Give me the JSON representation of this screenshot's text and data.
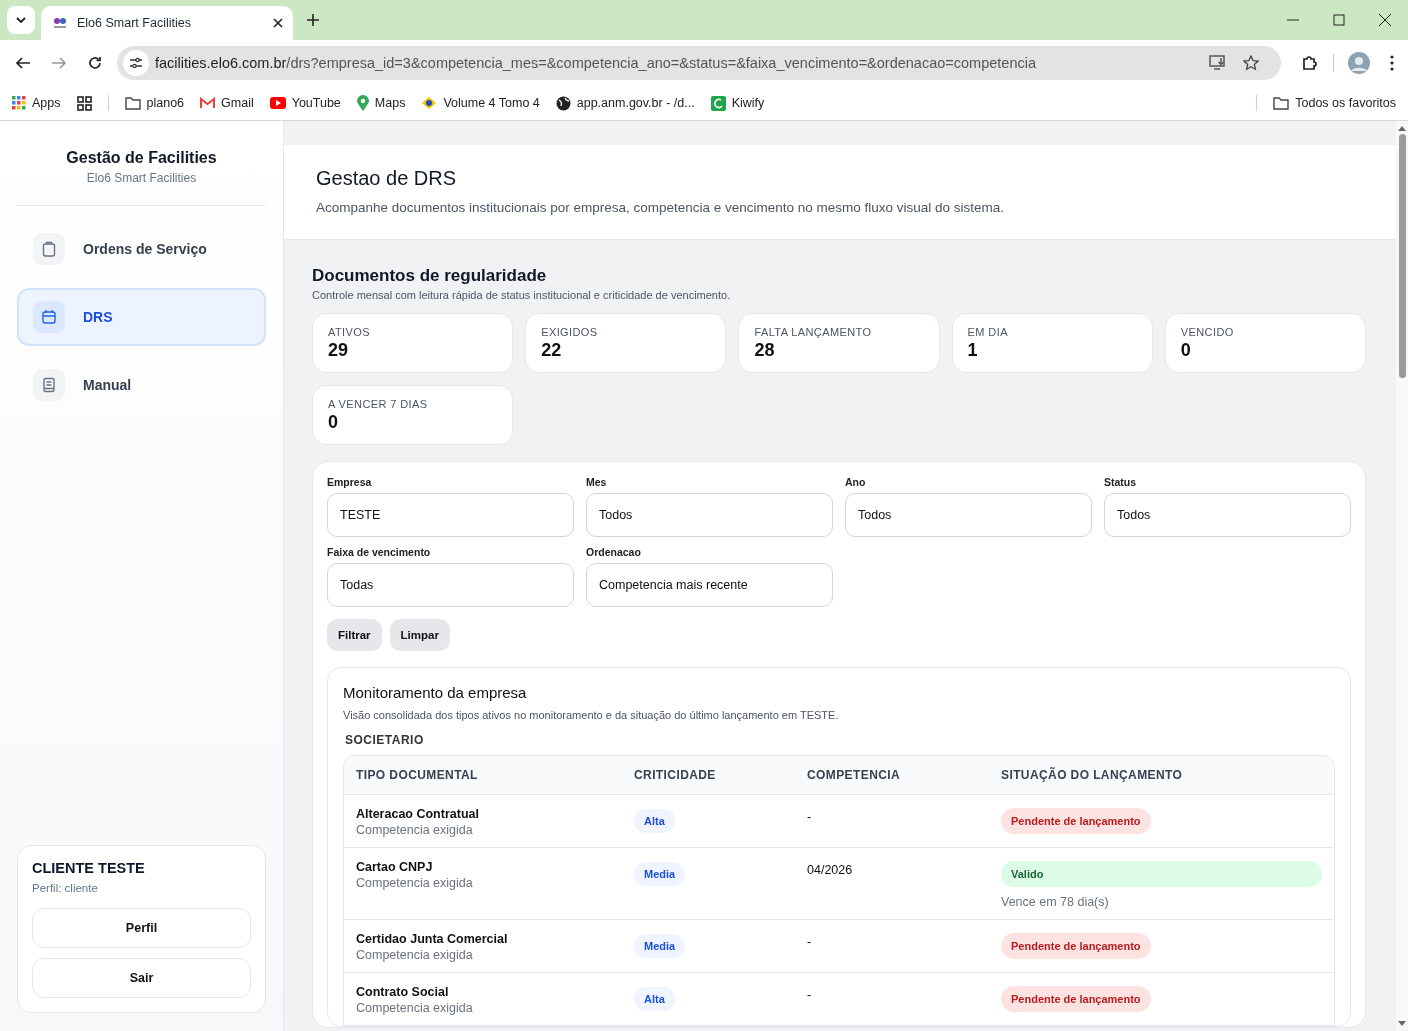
{
  "browser": {
    "tab_title": "Elo6 Smart Facilities",
    "url_host": "facilities.elo6.com.br",
    "url_path": "/drs?empresa_id=3&competencia_mes=&competencia_ano=&status=&faixa_vencimento=&ordenacao=competencia",
    "bookmarks": [
      {
        "label": "Apps",
        "kind": "apps"
      },
      {
        "kind": "grid"
      },
      {
        "label": "plano6",
        "kind": "folder"
      },
      {
        "label": "Gmail",
        "kind": "gmail"
      },
      {
        "label": "YouTube",
        "kind": "youtube"
      },
      {
        "label": "Maps",
        "kind": "maps"
      },
      {
        "label": "Volume 4 Tomo 4",
        "kind": "gov"
      },
      {
        "label": "app.anm.gov.br - /d...",
        "kind": "globe"
      },
      {
        "label": "Kiwify",
        "kind": "kiwify"
      }
    ],
    "all_bookmarks": "Todos os favoritos"
  },
  "sidebar": {
    "title": "Gestão de Facilities",
    "subtitle": "Elo6 Smart Facilities",
    "nav": [
      {
        "label": "Ordens de Serviço",
        "kind": "clipboard",
        "selected": false
      },
      {
        "label": "DRS",
        "kind": "calendar",
        "selected": true
      },
      {
        "label": "Manual",
        "kind": "book",
        "selected": false
      }
    ],
    "user": {
      "name": "CLIENTE TESTE",
      "role": "Perfil: cliente",
      "buttons": [
        "Perfil",
        "Sair"
      ]
    }
  },
  "header": {
    "title": "Gestao de DRS",
    "subtitle": "Acompanhe documentos institucionais por empresa, competencia e vencimento no mesmo fluxo visual do sistema."
  },
  "summary": {
    "title": "Documentos de regularidade",
    "subtitle": "Controle mensal com leitura rápida de status institucional e criticidade de vencimento.",
    "stats": [
      {
        "label": "ATIVOS",
        "value": "29"
      },
      {
        "label": "EXIGIDOS",
        "value": "22"
      },
      {
        "label": "FALTA LANÇAMENTO",
        "value": "28"
      },
      {
        "label": "EM DIA",
        "value": "1"
      },
      {
        "label": "VENCIDO",
        "value": "0"
      },
      {
        "label": "A VENCER 7 DIAS",
        "value": "0"
      }
    ]
  },
  "filters": {
    "fields": [
      {
        "label": "Empresa",
        "value": "TESTE"
      },
      {
        "label": "Mes",
        "value": "Todos"
      },
      {
        "label": "Ano",
        "value": "Todos"
      },
      {
        "label": "Status",
        "value": "Todos"
      },
      {
        "label": "Faixa de vencimento",
        "value": "Todas"
      },
      {
        "label": "Ordenacao",
        "value": "Competencia mais recente"
      }
    ],
    "actions": [
      "Filtrar",
      "Limpar"
    ]
  },
  "monitor": {
    "title": "Monitoramento da empresa",
    "subtitle": "Visão consolidada dos tipos ativos no monitoramento e da situação do último lançamento em TESTE.",
    "group": "SOCIETARIO",
    "columns": [
      "TIPO DOCUMENTAL",
      "CRITICIDADE",
      "COMPETENCIA",
      "SITUAÇÃO DO LANÇAMENTO"
    ],
    "rows": [
      {
        "document": "Alteracao Contratual",
        "note": "Competencia exigida",
        "criticality": "Alta",
        "competencia": "-",
        "status": {
          "label": "Pendente de lançamento",
          "kind": "pending"
        }
      },
      {
        "document": "Cartao CNPJ",
        "note": "Competencia exigida",
        "criticality": "Media",
        "competencia": "04/2026",
        "status": {
          "label": "Valido",
          "kind": "valid"
        },
        "due": "Vence em 78 dia(s)"
      },
      {
        "document": "Certidao Junta Comercial",
        "note": "Competencia exigida",
        "criticality": "Media",
        "competencia": "-",
        "status": {
          "label": "Pendente de lançamento",
          "kind": "pending"
        }
      },
      {
        "document": "Contrato Social",
        "note": "Competencia exigida",
        "criticality": "Alta",
        "competencia": "-",
        "status": {
          "label": "Pendente de lançamento",
          "kind": "pending"
        }
      }
    ]
  }
}
